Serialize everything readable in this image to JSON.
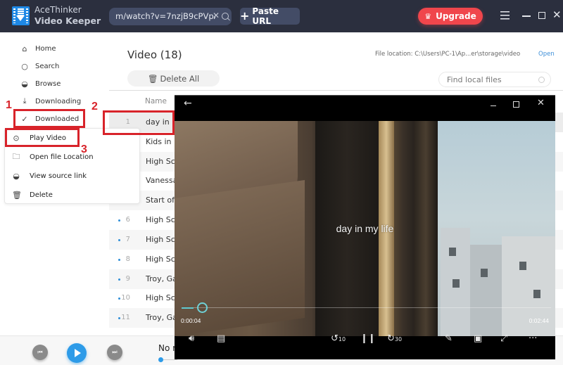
{
  "app": {
    "brand_line1": "AceThinker",
    "brand_line2": "Video Keeper",
    "url_value": "m/watch?v=7nzjB9cPVpA",
    "paste_url_label": "Paste URL",
    "upgrade_label": "Upgrade",
    "accent_color": "#2d9be8",
    "upgrade_color": "#f0464c",
    "annotation_color": "#d8232a"
  },
  "sidebar": {
    "items": [
      {
        "label": "Home",
        "icon": "home-icon"
      },
      {
        "label": "Search",
        "icon": "search-icon"
      },
      {
        "label": "Browse",
        "icon": "browse-icon"
      },
      {
        "label": "Downloading",
        "icon": "download-icon"
      },
      {
        "label": "Downloaded",
        "icon": "check-circle-icon"
      }
    ]
  },
  "context_menu": {
    "items": [
      {
        "label": "Play Video",
        "icon": "play-circle-icon"
      },
      {
        "label": "Open file Location",
        "icon": "folder-icon"
      },
      {
        "label": "View source link",
        "icon": "link-globe-icon"
      },
      {
        "label": "Delete",
        "icon": "trash-icon"
      }
    ]
  },
  "main": {
    "title": "Video (18)",
    "delete_all_label": "Delete All",
    "file_location": "File location: C:\\Users\\PC-1\\Ap...er\\storage\\video",
    "open_label": "Open",
    "find_placeholder": "Find local files",
    "column_name": "Name",
    "rows": [
      {
        "num": "1",
        "name": "day in m"
      },
      {
        "num": "",
        "name": "Kids in"
      },
      {
        "num": "",
        "name": "High Sc"
      },
      {
        "num": "",
        "name": "Vanessa"
      },
      {
        "num": "",
        "name": "Start of"
      },
      {
        "num": "6",
        "name": "High Sc"
      },
      {
        "num": "7",
        "name": "High Sc"
      },
      {
        "num": "8",
        "name": "High Sc"
      },
      {
        "num": "9",
        "name": "Troy, Ga"
      },
      {
        "num": "10",
        "name": "High Sc"
      },
      {
        "num": "11",
        "name": "Troy, Ga"
      }
    ]
  },
  "player_bar": {
    "now_playing": "No m"
  },
  "video_player": {
    "subtitle": "day in my life",
    "current_time": "0:00:04",
    "total_time": "0:02:44",
    "progress_fraction": 0.025,
    "rewind_label": "10",
    "forward_label": "30"
  },
  "annotations": [
    {
      "label": "1"
    },
    {
      "label": "2"
    },
    {
      "label": "3"
    }
  ]
}
